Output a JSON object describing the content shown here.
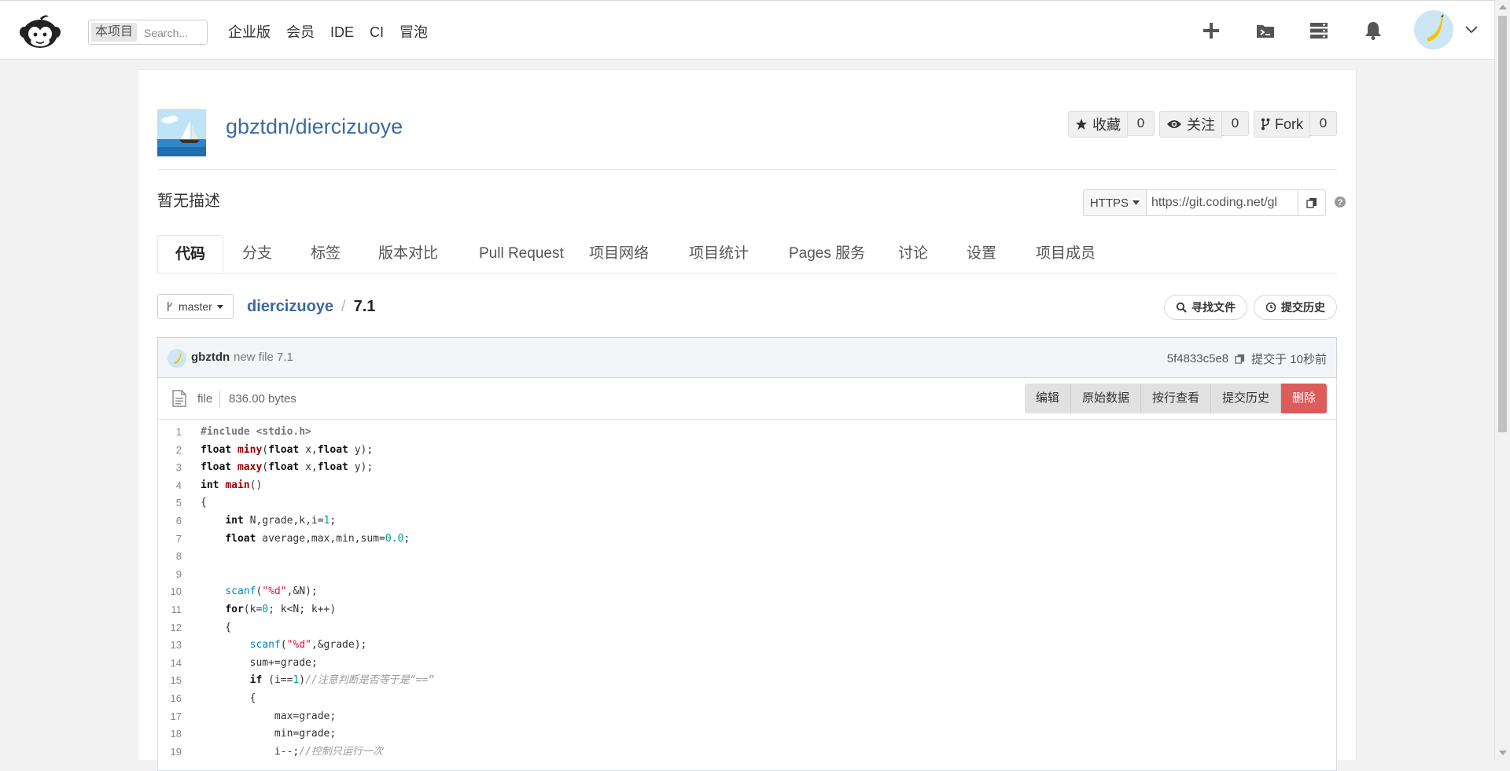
{
  "nav": {
    "scope_label": "本项目",
    "search_placeholder": "Search...",
    "links": [
      "企业版",
      "会员",
      "IDE",
      "CI",
      "冒泡"
    ]
  },
  "repo": {
    "title": "gbztdn/diercizuoye",
    "description": "暂无描述",
    "star_label": "收藏",
    "star_count": "0",
    "watch_label": "关注",
    "watch_count": "0",
    "fork_label": "Fork",
    "fork_count": "0"
  },
  "clone": {
    "protocol": "HTTPS",
    "url": "https://git.coding.net/gl"
  },
  "tabs": [
    "代码",
    "分支",
    "标签",
    "版本对比",
    "Pull Request",
    "项目网络",
    "项目统计",
    "Pages 服务",
    "讨论",
    "设置",
    "项目成员"
  ],
  "branch": "master",
  "breadcrumb": {
    "repo": "diercizuoye",
    "file": "7.1"
  },
  "actions": {
    "find_file": "寻找文件",
    "history": "提交历史"
  },
  "commit": {
    "author": "gbztdn",
    "message": "new file 7.1",
    "hash": "5f4833c5e8",
    "time": "提交于 10秒前"
  },
  "file": {
    "kind": "file",
    "size": "836.00 bytes",
    "buttons": [
      "编辑",
      "原始数据",
      "按行查看",
      "提交历史"
    ],
    "delete_label": "删除"
  },
  "code_lines": [
    "#include <stdio.h>",
    "float miny(float x,float y);",
    "float maxy(float x,float y);",
    "int main()",
    "{",
    "    int N,grade,k,i=1;",
    "    float average,max,min,sum=0.0;",
    "",
    "",
    "    scanf(\"%d\",&N);",
    "    for(k=0; k<N; k++)",
    "    {",
    "        scanf(\"%d\",&grade);",
    "        sum+=grade;",
    "        if (i==1)//注意判断是否等于是“==”",
    "        {",
    "            max=grade;",
    "            min=grade;",
    "            i--;//控制只运行一次"
  ]
}
